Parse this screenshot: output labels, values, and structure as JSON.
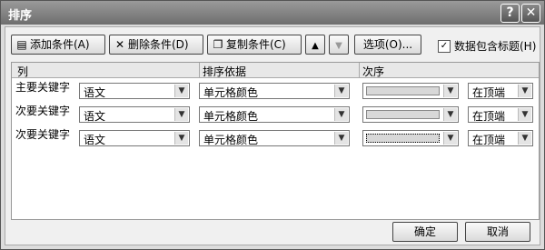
{
  "window": {
    "title": "排序",
    "help_glyph": "?",
    "close_glyph": "✕"
  },
  "toolbar": {
    "add_label": "添加条件(A)",
    "delete_label": "删除条件(D)",
    "copy_label": "复制条件(C)",
    "up_glyph": "▲",
    "down_glyph": "▼",
    "options_label": "选项(O)...",
    "header_checkbox_label": "数据包含标题(H)",
    "header_checkbox_checked": true
  },
  "grid": {
    "headers": {
      "column": "列",
      "sort_on": "排序依据",
      "order": "次序"
    },
    "rows": [
      {
        "label": "主要关键字",
        "column": "语文",
        "sort_on": "单元格颜色",
        "position": "在顶端"
      },
      {
        "label": "次要关键字",
        "column": "语文",
        "sort_on": "单元格颜色",
        "position": "在顶端"
      },
      {
        "label": "次要关键字",
        "column": "语文",
        "sort_on": "单元格颜色",
        "position": "在顶端"
      }
    ]
  },
  "footer": {
    "ok_label": "确定",
    "cancel_label": "取消"
  }
}
